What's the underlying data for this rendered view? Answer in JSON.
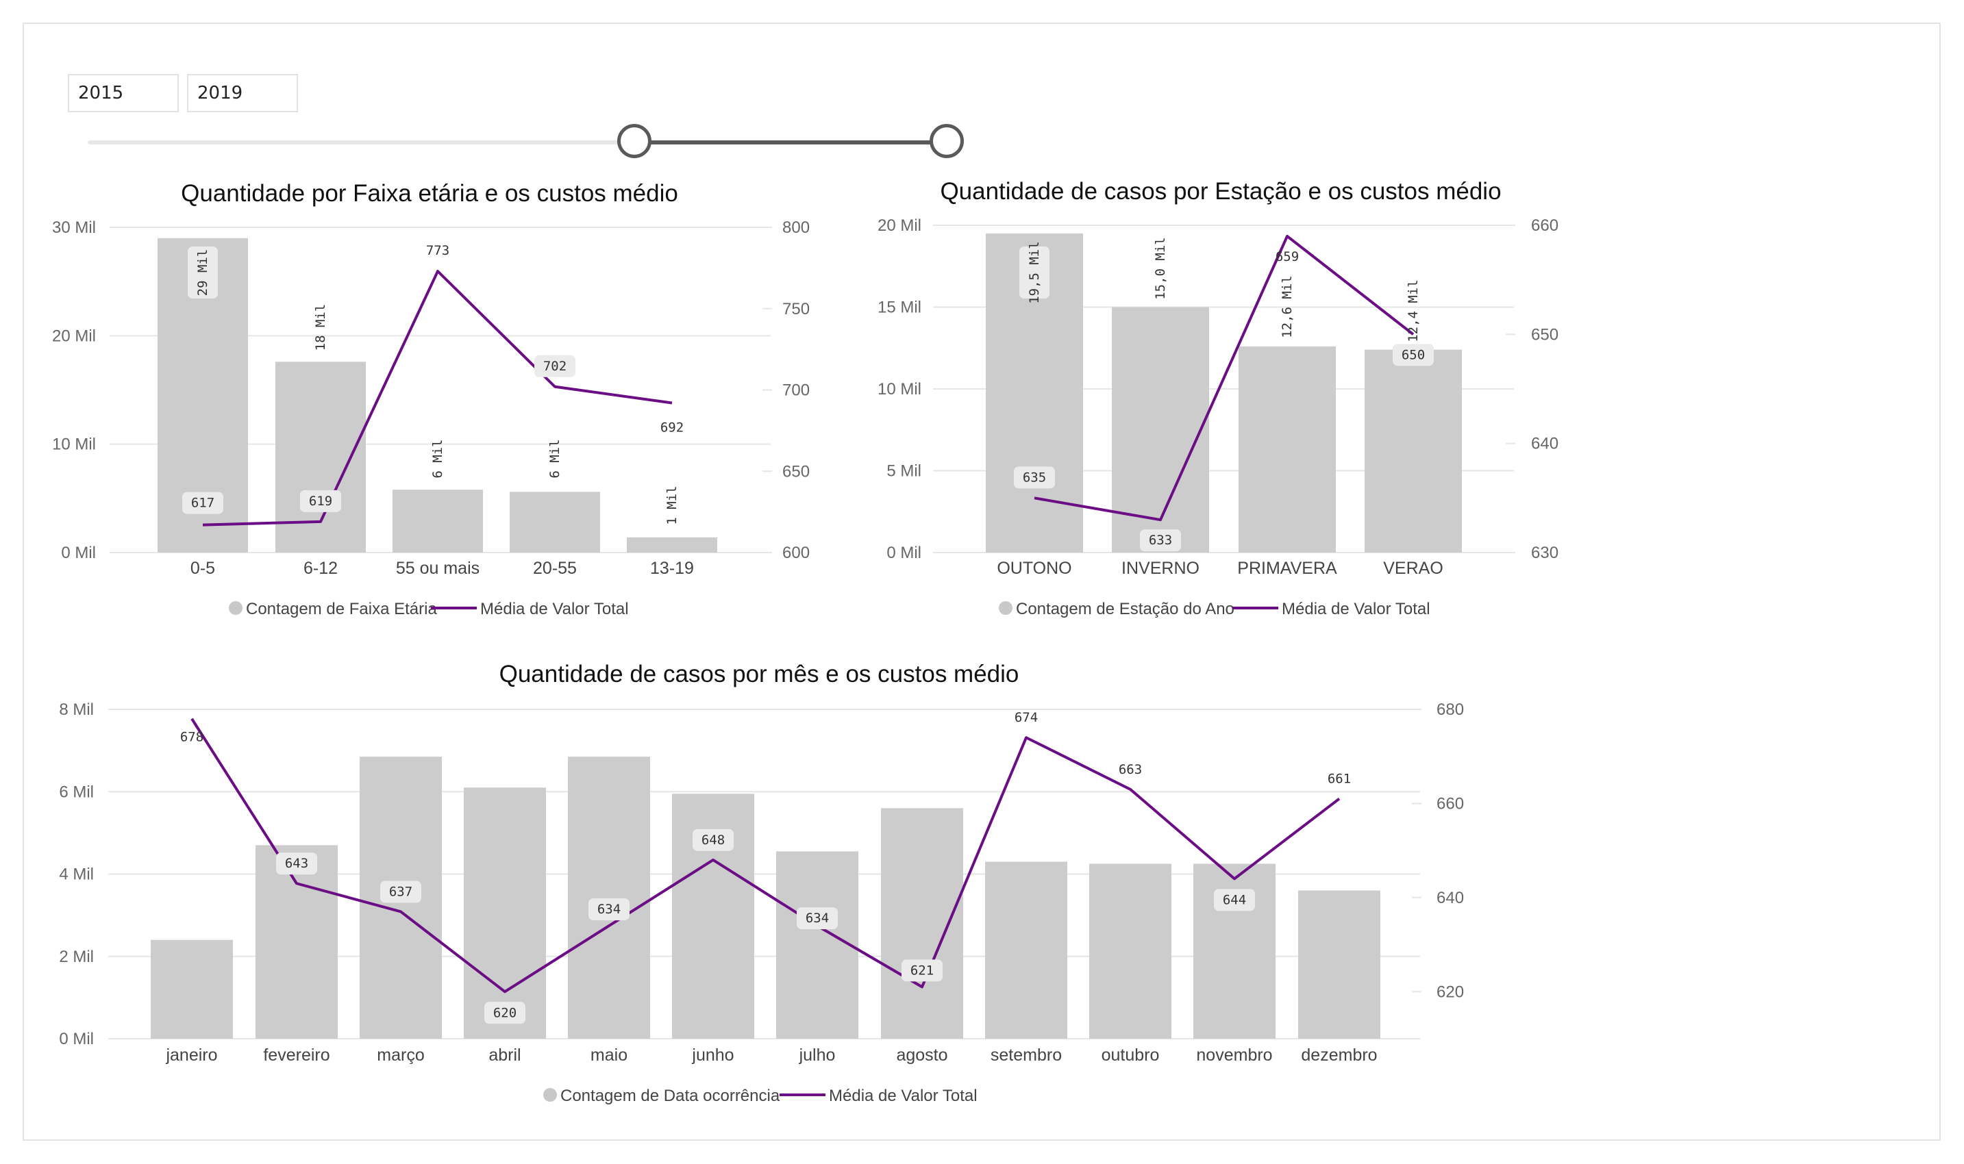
{
  "filters": {
    "year_from": "2015",
    "year_to": "2019",
    "slider_range": [
      2015,
      2019
    ]
  },
  "colors": {
    "bar": "#cccccc",
    "line": "#6b0d84",
    "label_bg": "#ebebeb"
  },
  "chart_data": [
    {
      "type": "bar",
      "title": "Quantidade por Faixa etária e os custos médio",
      "categories": [
        "0-5",
        "6-12",
        "55 ou mais",
        "20-55",
        "13-19"
      ],
      "series": [
        {
          "name": "Contagem de Faixa Etária",
          "type": "bar",
          "axis": "left",
          "values": [
            29000,
            17600,
            5800,
            5600,
            1400
          ],
          "labels": [
            "29 Mil",
            "18 Mil",
            "6 Mil",
            "6 Mil",
            "1 Mil"
          ]
        },
        {
          "name": "Média de Valor Total",
          "type": "line",
          "axis": "right",
          "values": [
            617,
            619,
            773,
            702,
            692
          ],
          "labels": [
            "617",
            "619",
            "773",
            "702",
            "692"
          ]
        }
      ],
      "left_axis": {
        "min": 0,
        "max": 30000,
        "ticks": [
          0,
          10000,
          20000,
          30000
        ],
        "tick_labels": [
          "0 Mil",
          "10 Mil",
          "20 Mil",
          "30 Mil"
        ]
      },
      "right_axis": {
        "min": 600,
        "max": 800,
        "ticks": [
          600,
          650,
          700,
          750,
          800
        ],
        "tick_labels": [
          "600",
          "650",
          "700",
          "750",
          "800"
        ]
      },
      "grid": true,
      "legend": "bottom-center"
    },
    {
      "type": "bar",
      "title": "Quantidade de casos por Estação e os custos médio",
      "categories": [
        "OUTONO",
        "INVERNO",
        "PRIMAVERA",
        "VERAO"
      ],
      "series": [
        {
          "name": "Contagem de Estação do Ano",
          "type": "bar",
          "axis": "left",
          "values": [
            19500,
            15000,
            12600,
            12400
          ],
          "labels": [
            "19,5 Mil",
            "15,0 Mil",
            "12,6 Mil",
            "12,4 Mil"
          ]
        },
        {
          "name": "Média de Valor Total",
          "type": "line",
          "axis": "right",
          "values": [
            635,
            633,
            659,
            650
          ],
          "labels": [
            "635",
            "633",
            "659",
            "650"
          ]
        }
      ],
      "left_axis": {
        "min": 0,
        "max": 20000,
        "ticks": [
          0,
          5000,
          10000,
          15000,
          20000
        ],
        "tick_labels": [
          "0 Mil",
          "5 Mil",
          "10 Mil",
          "15 Mil",
          "20 Mil"
        ]
      },
      "right_axis": {
        "min": 630,
        "max": 660,
        "ticks": [
          630,
          640,
          650,
          660
        ],
        "tick_labels": [
          "630",
          "640",
          "650",
          "660"
        ]
      },
      "grid": true,
      "legend": "bottom-center"
    },
    {
      "type": "bar",
      "title": "Quantidade de casos por mês e os custos médio",
      "categories": [
        "janeiro",
        "fevereiro",
        "março",
        "abril",
        "maio",
        "junho",
        "julho",
        "agosto",
        "setembro",
        "outubro",
        "novembro",
        "dezembro"
      ],
      "series": [
        {
          "name": "Contagem de Data ocorrência",
          "type": "bar",
          "axis": "left",
          "values": [
            2400,
            4700,
            6850,
            6100,
            6850,
            5950,
            4550,
            5600,
            4300,
            4250,
            4250,
            3600
          ]
        },
        {
          "name": "Média de Valor Total",
          "type": "line",
          "axis": "right",
          "values": [
            678,
            643,
            637,
            620,
            634,
            648,
            634,
            621,
            674,
            663,
            644,
            661
          ],
          "labels": [
            "678",
            "643",
            "637",
            "620",
            "634",
            "648",
            "634",
            "621",
            "674",
            "663",
            "644",
            "661"
          ]
        }
      ],
      "left_axis": {
        "min": 0,
        "max": 8000,
        "ticks": [
          0,
          2000,
          4000,
          6000,
          8000
        ],
        "tick_labels": [
          "0 Mil",
          "2 Mil",
          "4 Mil",
          "6 Mil",
          "8 Mil"
        ]
      },
      "right_axis": {
        "min": 610,
        "max": 680,
        "ticks": [
          620,
          640,
          660,
          680
        ],
        "tick_labels": [
          "620",
          "640",
          "660",
          "680"
        ]
      },
      "grid": true,
      "legend": "bottom-center"
    }
  ]
}
